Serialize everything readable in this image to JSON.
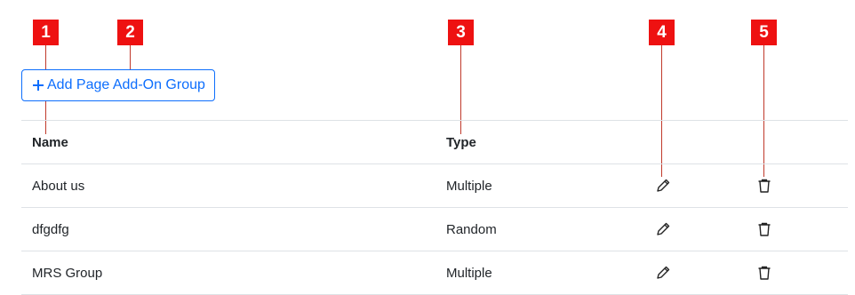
{
  "callouts": [
    "1",
    "2",
    "3",
    "4",
    "5"
  ],
  "toolbar": {
    "add_label": "Add Page Add-On Group"
  },
  "table": {
    "headers": {
      "name": "Name",
      "type": "Type"
    },
    "rows": [
      {
        "name": "About us",
        "type": "Multiple"
      },
      {
        "name": "dfgdfg",
        "type": "Random"
      },
      {
        "name": "MRS Group",
        "type": "Multiple"
      }
    ]
  },
  "icons": {
    "add": "plus-icon",
    "edit": "pencil-icon",
    "delete": "trash-icon"
  },
  "colors": {
    "accent": "#0d6efd",
    "callout": "#ee1111",
    "border": "#dee2e6"
  }
}
